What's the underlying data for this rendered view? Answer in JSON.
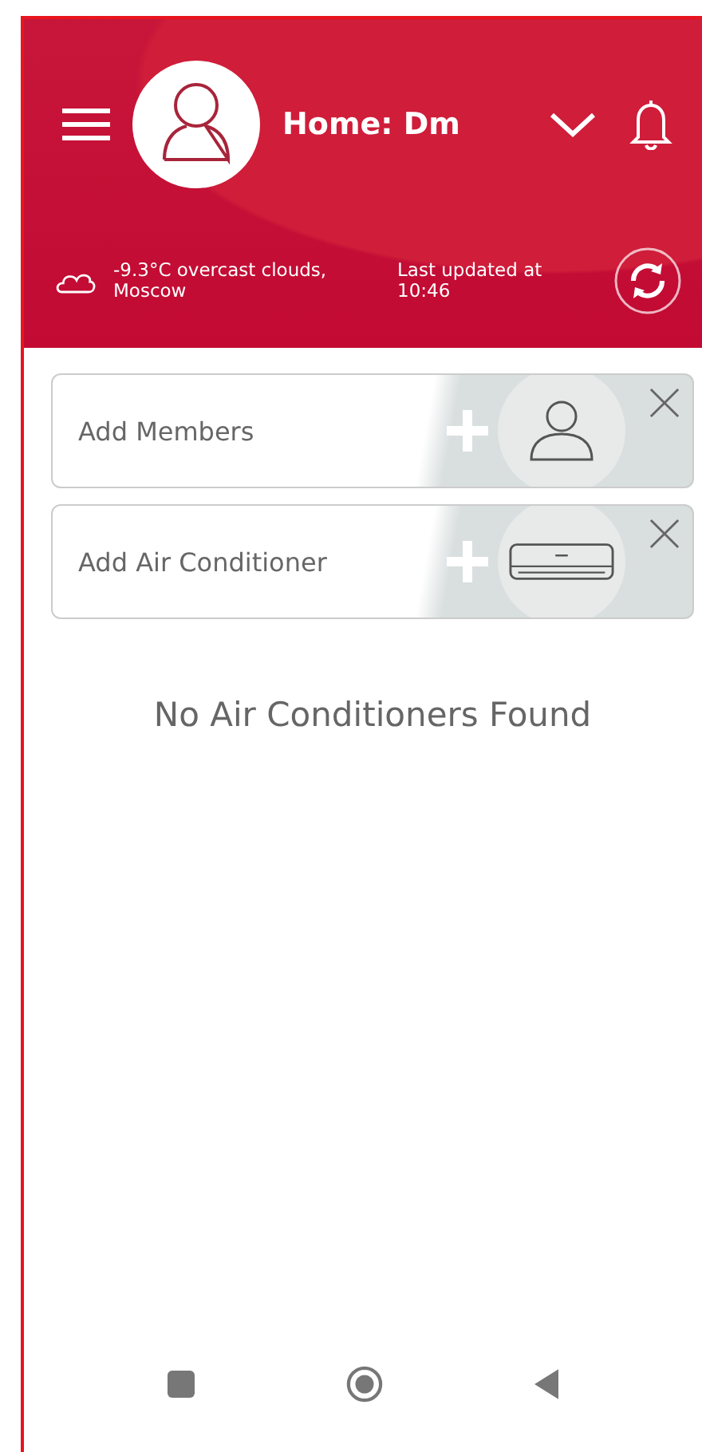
{
  "header": {
    "title": "Home: Dm"
  },
  "weather": {
    "text": "-9.3°C  overcast clouds, Moscow",
    "updated_label": "Last updated at",
    "updated_time": "10:46"
  },
  "cards": [
    {
      "kind": "member",
      "label": "Add Members"
    },
    {
      "kind": "ac",
      "label": "Add Air Conditioner"
    }
  ],
  "empty_message": "No Air Conditioners Found"
}
